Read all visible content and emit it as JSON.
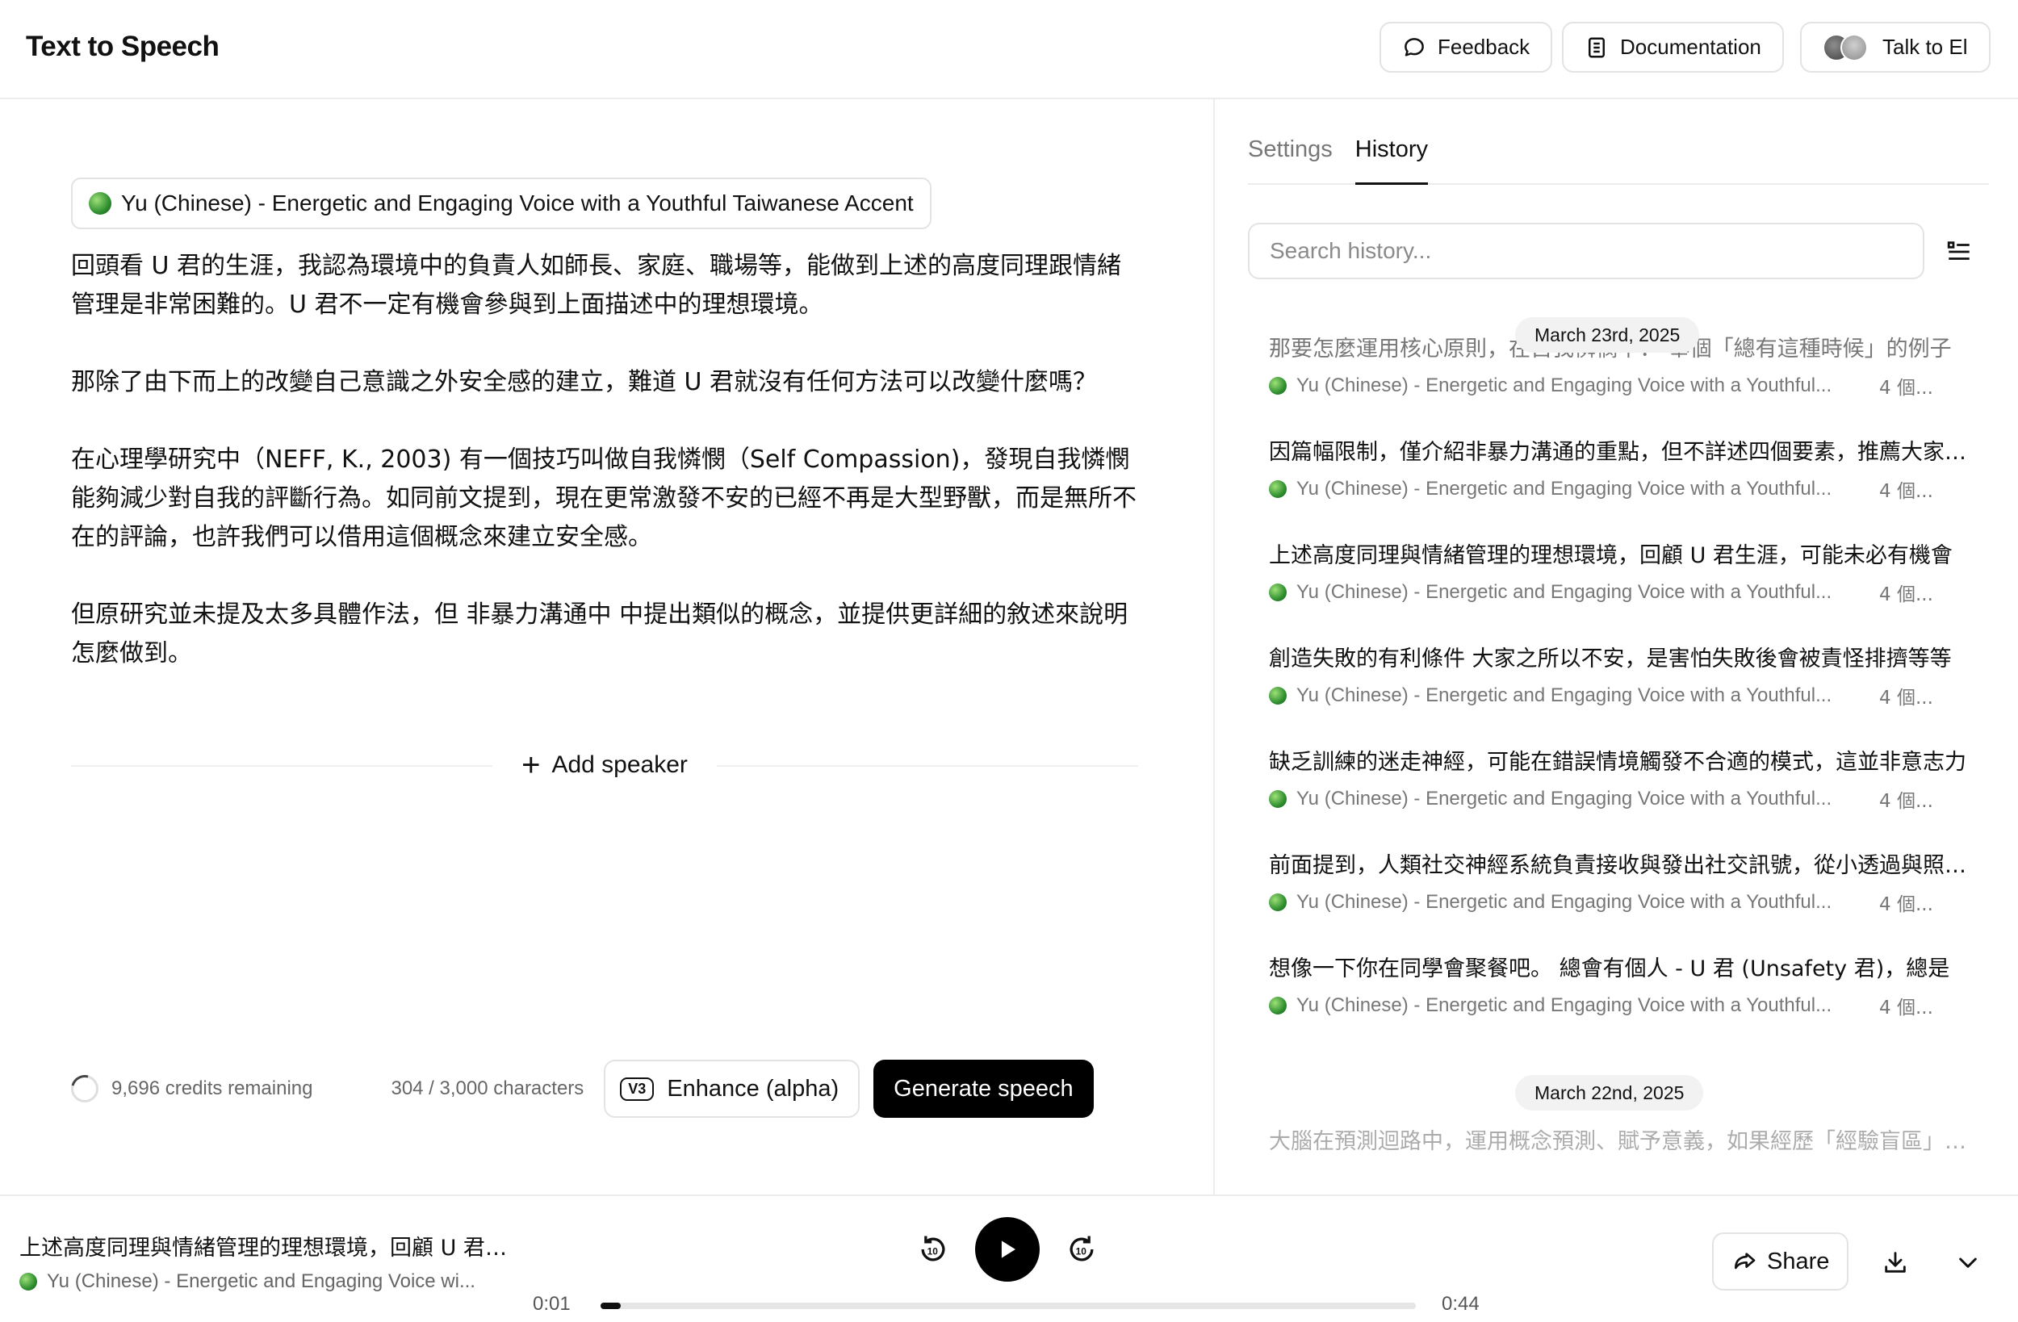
{
  "header": {
    "title": "Text to Speech",
    "feedback_label": "Feedback",
    "docs_label": "Documentation",
    "talk_label": "Talk to El"
  },
  "editor": {
    "voice_name": "Yu (Chinese) - Energetic and Engaging Voice with a Youthful Taiwanese Accent",
    "paragraphs": [
      "回頭看 U 君的生涯，我認為環境中的負責人如師長、家庭、職場等，能做到上述的高度同理跟情緒管理是非常困難的。U 君不一定有機會參與到上面描述中的理想環境。",
      "那除了由下而上的改變自己意識之外安全感的建立，難道 U 君就沒有任何方法可以改變什麼嗎？",
      "在心理學研究中（NEFF, K., 2003) 有一個技巧叫做自我憐憫（Self Compassion)，發現自我憐憫能夠減少對自我的評斷行為。如同前文提到，現在更常激發不安的已經不再是大型野獸，而是無所不在的評論，也許我們可以借用這個概念來建立安全感。",
      "但原研究並未提及太多具體作法，但 非暴力溝通中 中提出類似的概念，並提供更詳細的敘述來說明怎麼做到。"
    ],
    "add_speaker_label": "Add speaker",
    "credits": "9,696 credits remaining",
    "char_count": "304 / 3,000 characters",
    "enhance_badge": "V3",
    "enhance_label": "Enhance (alpha)",
    "generate_label": "Generate speech"
  },
  "sidebar": {
    "tabs": [
      "Settings",
      "History"
    ],
    "active_tab": "History",
    "search_placeholder": "Search history...",
    "date_groups": [
      "March 23rd, 2025",
      "March 22nd, 2025"
    ],
    "history": [
      {
        "text": "那要怎麼運用核心原則，在自我憐憫中： 舉個「總有這種時候」的例子",
        "voice": "Yu (Chinese) - Energetic and Engaging Voice with a Youthful...",
        "count": "4 個..."
      },
      {
        "text": "因篇幅限制，僅介紹非暴力溝通的重點，但不詳述四個要素，推薦大家閱讀",
        "voice": "Yu (Chinese) - Energetic and Engaging Voice with a Youthful...",
        "count": "4 個..."
      },
      {
        "text": "上述高度同理與情緒管理的理想環境，回顧 U 君生涯，可能未必有機會",
        "voice": "Yu (Chinese) - Energetic and Engaging Voice with a Youthful...",
        "count": "4 個..."
      },
      {
        "text": "創造失敗的有利條件 大家之所以不安，是害怕失敗後會被責怪排擠等等",
        "voice": "Yu (Chinese) - Energetic and Engaging Voice with a Youthful...",
        "count": "4 個..."
      },
      {
        "text": "缺乏訓練的迷走神經，可能在錯誤情境觸發不合適的模式，這並非意志力",
        "voice": "Yu (Chinese) - Energetic and Engaging Voice with a Youthful...",
        "count": "4 個..."
      },
      {
        "text": "前面提到，人類社交神經系統負責接收與發出社交訊號，從小透過與照顧者",
        "voice": "Yu (Chinese) - Energetic and Engaging Voice with a Youthful...",
        "count": "4 個..."
      },
      {
        "text": "想像一下你在同學會聚餐吧。 總會有個人 - U 君 (Unsafety 君)，總是",
        "voice": "Yu (Chinese) - Energetic and Engaging Voice with a Youthful...",
        "count": "4 個..."
      }
    ],
    "faded_item": "大腦在預測迴路中，運用概念預測、賦予意義，如果經歷「經驗盲區」的時候"
  },
  "player": {
    "title": "上述高度同理與情緒管理的理想環境，回顧 U 君生涯，可能未必有機會",
    "voice": "Yu (Chinese) - Energetic and Engaging Voice wi...",
    "current_time": "0:01",
    "total_time": "0:44",
    "progress": 0.025,
    "share_label": "Share"
  }
}
